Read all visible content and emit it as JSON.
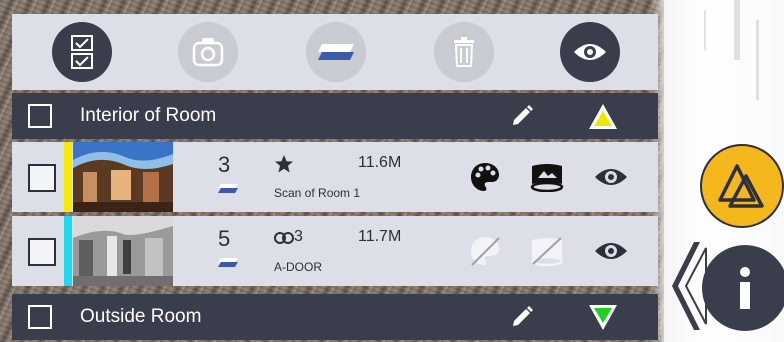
{
  "toolbar": {
    "buttons": [
      {
        "icon": "checklist-icon",
        "state": "active"
      },
      {
        "icon": "camera-icon",
        "state": "disabled"
      },
      {
        "icon": "layers-icon",
        "state": "disabled"
      },
      {
        "icon": "trash-icon",
        "state": "disabled"
      },
      {
        "icon": "eye-icon",
        "state": "active"
      }
    ]
  },
  "groups": [
    {
      "title": "Interior of Room",
      "expanded": true,
      "triangle_color": "#f2e600",
      "scans": [
        {
          "count": "3",
          "attr_icon": "star-icon",
          "size": "11.6M",
          "name": "Scan of Room 1",
          "color": "#f6ea00",
          "palette_enabled": true,
          "panorama_enabled": true
        },
        {
          "count": "5",
          "attr_icon": "link-icon",
          "link_count": "3",
          "size": "11.7M",
          "name": "A-DOOR",
          "color": "#1fd7ee",
          "palette_enabled": false,
          "panorama_enabled": false
        }
      ]
    },
    {
      "title": "Outside Room",
      "expanded": false,
      "triangle_color": "#22d11f"
    }
  ],
  "colors": {
    "dark": "#3a3d4b",
    "panel": "#dcdfe8",
    "warning": "#f4b81c"
  },
  "fabs": {
    "warning": "warning-icon",
    "info": "info-icon"
  }
}
